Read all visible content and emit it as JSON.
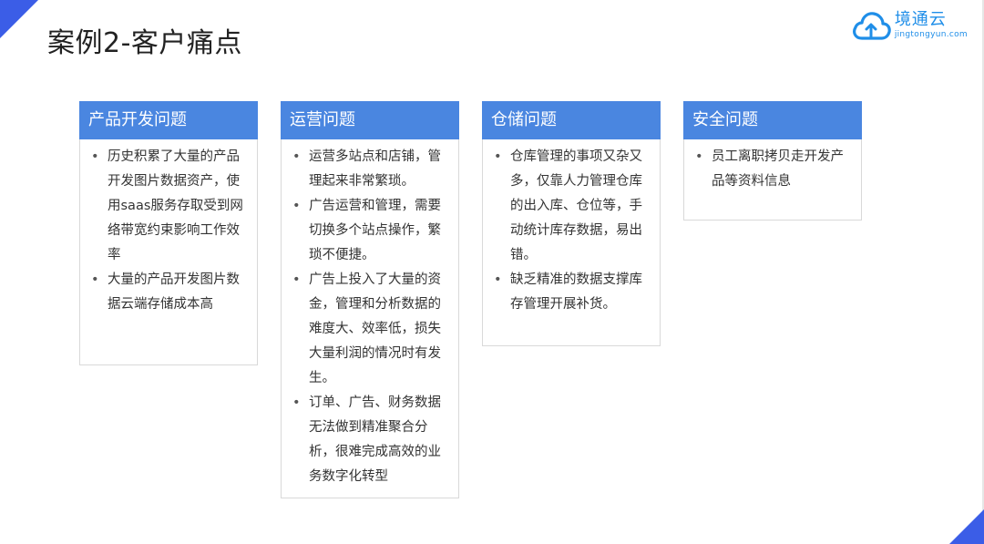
{
  "slide": {
    "title": "案例2-客户痛点",
    "brand": {
      "name": "境通云",
      "url": "jingtongyun.com",
      "icon": "cloud-upload-icon",
      "color": "#1f8ee8"
    },
    "accent_color": "#3b5de7",
    "header_color": "#4a86e0"
  },
  "cards": [
    {
      "title": "产品开发问题",
      "items": [
        "历史积累了大量的产品开发图片数据资产，使用saas服务存取受到网络带宽约束影响工作效率",
        "大量的产品开发图片数据云端存储成本高"
      ]
    },
    {
      "title": "运营问题",
      "items": [
        "运营多站点和店铺，管理起来非常繁琐。",
        "广告运营和管理，需要切换多个站点操作，繁琐不便捷。",
        "广告上投入了大量的资金，管理和分析数据的难度大、效率低，损失大量利润的情况时有发生。",
        "订单、广告、财务数据无法做到精准聚合分析，很难完成高效的业务数字化转型"
      ]
    },
    {
      "title": "仓储问题",
      "items": [
        "仓库管理的事项又杂又多，仅靠人力管理仓库的出入库、仓位等，手动统计库存数据，易出错。",
        "缺乏精准的数据支撑库存管理开展补货。"
      ]
    },
    {
      "title": "安全问题",
      "items": [
        "员工离职拷贝走开发产品等资料信息"
      ]
    }
  ]
}
